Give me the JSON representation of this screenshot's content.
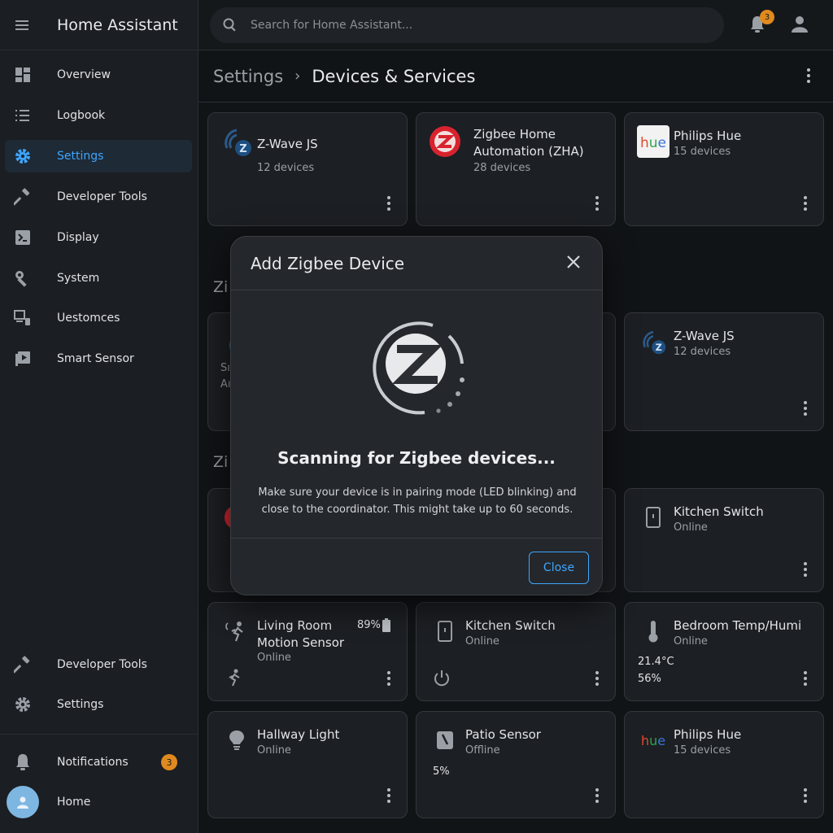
{
  "app": {
    "title": "Home Assistant"
  },
  "search": {
    "placeholder": "Search for Home Assistant..."
  },
  "notifications_count": "3",
  "sidebar": {
    "items": [
      {
        "label": "Overview",
        "icon": "dashboard-icon"
      },
      {
        "label": "Logbook",
        "icon": "list-icon"
      },
      {
        "label": "Settings",
        "icon": "gear-icon"
      },
      {
        "label": "Developer Tools",
        "icon": "hammer-icon"
      },
      {
        "label": "Display",
        "icon": "terminal-icon"
      },
      {
        "label": "System",
        "icon": "wrench-icon"
      },
      {
        "label": "Uestomces",
        "icon": "device-icon"
      },
      {
        "label": "Smart Sensor",
        "icon": "media-icon"
      }
    ],
    "bottom": [
      {
        "label": "Developer Tools",
        "icon": "hammer-icon"
      },
      {
        "label": "Settings",
        "icon": "gear-icon"
      }
    ],
    "notifications": {
      "label": "Notifications",
      "badge": "3"
    },
    "profile": {
      "label": "Home"
    }
  },
  "breadcrumb": {
    "parent": "Settings",
    "current": "Devices & Services"
  },
  "integrations": [
    {
      "title": "Z-Wave JS",
      "subtitle": "12 devices",
      "icon": "zwave-icon"
    },
    {
      "title": "Zigbee Home Automation (ZHA)",
      "subtitle": "28 devices",
      "icon": "zha-icon"
    },
    {
      "title": "Philips Hue",
      "subtitle": "15 devices",
      "icon": "hue-logo-icon"
    }
  ],
  "sections": {
    "second": "Zi",
    "third": "Zi"
  },
  "partial_card": {
    "line1": "Sı",
    "line2": "Aı"
  },
  "row2_card": {
    "title": "Z-Wave JS",
    "subtitle": "12 devices"
  },
  "row3_card": {
    "title": "Kitchen Switch",
    "subtitle": "Online"
  },
  "devices": [
    {
      "title": "Living Room Motion Sensor",
      "status": "Online",
      "battery": "89%"
    },
    {
      "title": "Kitchen Switch",
      "status": "Online"
    },
    {
      "title": "Bedroom Temp/Humi",
      "status": "Online",
      "temperature": "21.4°C",
      "humidity": "56%"
    },
    {
      "title": "Hallway Light",
      "status": "Online"
    },
    {
      "title": "Patio Sensor",
      "status": "Offline",
      "battery": "5%"
    },
    {
      "title": "Philips Hue",
      "status": "15 devices"
    }
  ],
  "dialog": {
    "title": "Add Zigbee Device",
    "heading": "Scanning for Zigbee devices...",
    "body": "Make sure your device is in pairing mode (LED blinking) and close to the coordinator. This might take up to 60 seconds.",
    "button": "Close"
  },
  "colors": {
    "accent": "#3ea6ff",
    "badge": "#e08a1e",
    "zha_red": "#d8232f",
    "background": "#111417"
  }
}
